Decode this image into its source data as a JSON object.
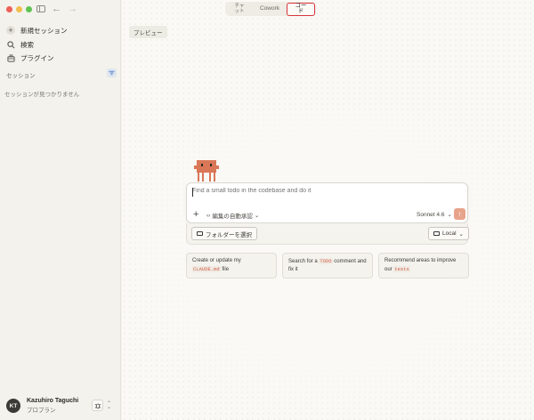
{
  "titlebar": {
    "tabs": [
      {
        "label": "チャット"
      },
      {
        "label": "Cowork"
      },
      {
        "label": "コード",
        "active": true
      }
    ],
    "back_icon": "arrow-left-icon",
    "forward_icon": "arrow-right-icon"
  },
  "sidebar": {
    "items": [
      {
        "label": "新規セッション",
        "icon": "plus-circle-icon"
      },
      {
        "label": "検索",
        "icon": "search-icon"
      },
      {
        "label": "プラグイン",
        "icon": "briefcase-icon"
      }
    ],
    "section_title": "セッション",
    "empty_message": "セッションが見つかりません",
    "user": {
      "initials": "KT",
      "name": "Kazuhiro Taguchi",
      "plan": "プロプラン"
    }
  },
  "main": {
    "preview_label": "プレビュー",
    "prompt": {
      "placeholder": "Find a small todo in the codebase and do it",
      "mode_label": "編集の自動承認",
      "model_label": "Sonnet 4.6",
      "send_icon": "arrow-up-icon"
    },
    "folder_button": "フォルダーを選択",
    "env_button": "Local",
    "suggestions": [
      {
        "pre": "Create or update my ",
        "code": "CLAUDE.md",
        "post": " file"
      },
      {
        "pre": "Search for a ",
        "code": "TODO",
        "post": " comment and fix it"
      },
      {
        "pre": "Recommend areas to improve our ",
        "code": "tests",
        "post": ""
      }
    ]
  },
  "colors": {
    "accent_red": "#d8343a",
    "mascot": "#d97757",
    "send": "#e8a48b"
  }
}
